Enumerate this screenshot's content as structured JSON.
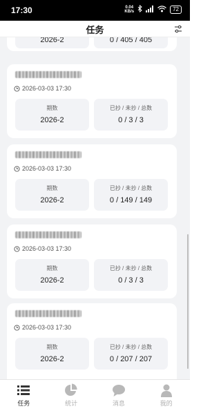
{
  "status_bar": {
    "time": "17:30",
    "net_speed_value": "0.04",
    "net_speed_unit": "KB/s",
    "battery": "72"
  },
  "header": {
    "title": "任务",
    "filter_icon": "filter-sliders-icon"
  },
  "top_partial": {
    "period_value": "2026-2",
    "count_value": "0 / 405 / 405"
  },
  "cards": [
    {
      "date": "2026-03-03 17:30",
      "period_label": "期数",
      "period_value": "2026-2",
      "count_label": "已抄 / 未抄 / 总数",
      "count_value": "0 / 3 / 3"
    },
    {
      "date": "2026-03-03 17:30",
      "period_label": "期数",
      "period_value": "2026-2",
      "count_label": "已抄 / 未抄 / 总数",
      "count_value": "0 / 149 / 149"
    },
    {
      "date": "2026-03-03 17:30",
      "period_label": "期数",
      "period_value": "2026-2",
      "count_label": "已抄 / 未抄 / 总数",
      "count_value": "0 / 3 / 3"
    },
    {
      "date": "2026-03-03 17:30",
      "period_label": "期数",
      "period_value": "2026-2",
      "count_label": "已抄 / 未抄 / 总数",
      "count_value": "0 / 207 / 207"
    }
  ],
  "tabbar": {
    "items": [
      {
        "label": "任务",
        "icon": "list-icon",
        "active": true
      },
      {
        "label": "统计",
        "icon": "pie-chart-icon",
        "active": false
      },
      {
        "label": "消息",
        "icon": "chat-bubble-icon",
        "active": false
      },
      {
        "label": "我的",
        "icon": "user-icon",
        "active": false
      }
    ]
  },
  "colors": {
    "active": "#333333",
    "inactive": "#b0b0b0",
    "background": "#f2f3f5"
  }
}
